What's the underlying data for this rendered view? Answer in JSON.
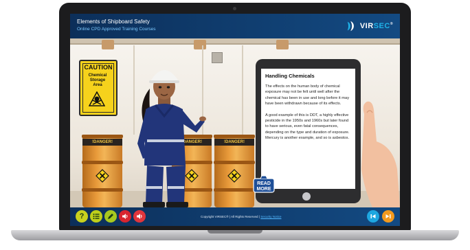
{
  "course": {
    "title": "Elements of Shipboard Safety",
    "subtitle": "Online CPD Approved Training Courses"
  },
  "brand": {
    "name_prefix": "VIR",
    "name_accent": "SEC",
    "trademark": "®",
    "logo_icon": "virsec-logo-icon"
  },
  "scene": {
    "caution_sign": {
      "heading": "CAUTION",
      "lines": [
        "Chemical",
        "Storage",
        "Area"
      ],
      "icon": "skull-crossbones-icon"
    },
    "drum_label": "!DANGER!",
    "drum_icon": "hazard-x-icon"
  },
  "panel": {
    "heading": "Handling Chemicals",
    "paragraphs": [
      "The effects on the human body of chemical exposure may not be felt until well after the chemical has been in use and long before it may have been withdrawn because of its effects.",
      "A good example of this is DDT, a highly effective pesticide in the 1950s and 1960s but later found to have serious, even fatal consequences, depending on the type and duration of exposure. Mercury is another example, and so is asbestos."
    ],
    "read_more_line1": "READ",
    "read_more_line2": "MORE"
  },
  "controls": {
    "help_label": "?",
    "copyright": "Copyright VIRSEC® | All Rights Reserved |",
    "security_link": "Security Notice"
  },
  "colors": {
    "header": "#0c2f5a",
    "help": "#c9d11e",
    "menu": "#bfcf1a",
    "notes": "#a8c81f",
    "audio_a": "#d9252f",
    "audio_b": "#e0353c",
    "prev": "#1ea7e0",
    "next": "#f39a1e"
  }
}
